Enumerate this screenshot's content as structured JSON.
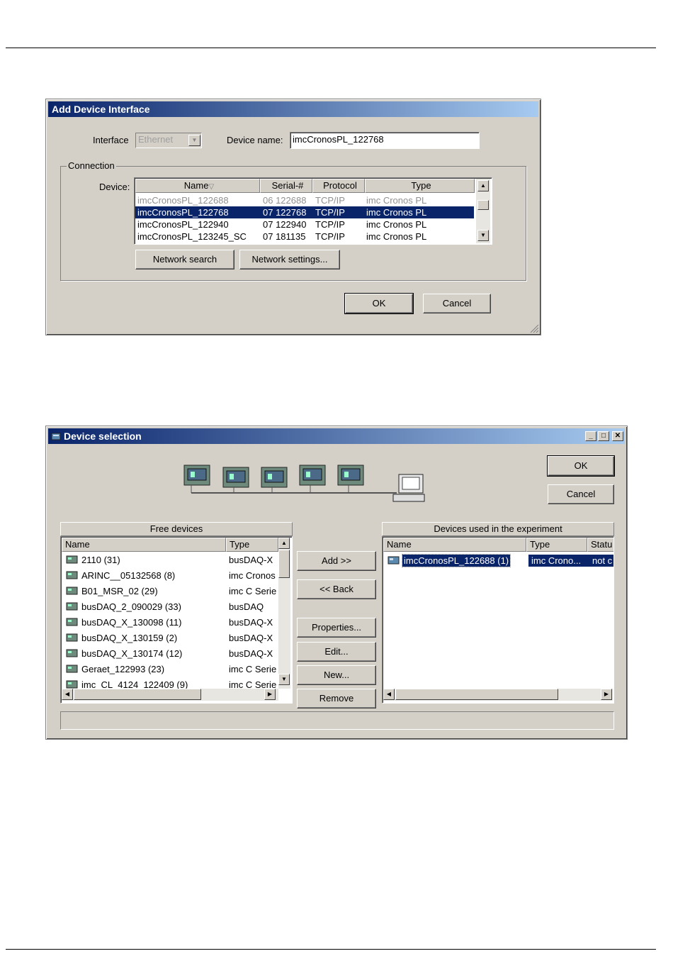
{
  "dialog1": {
    "title": "Add Device Interface",
    "interface_label": "Interface",
    "interface_value": "Ethernet",
    "device_name_label": "Device name:",
    "device_name_value": "imcCronosPL_122768",
    "connection_label": "Connection",
    "device_label": "Device:",
    "columns": [
      "Name",
      "Serial-#",
      "Protocol",
      "Type"
    ],
    "rows": [
      {
        "name": "imcCronosPL_122688",
        "serial": "06 122688",
        "protocol": "TCP/IP",
        "type": "imc Cronos PL"
      },
      {
        "name": "imcCronosPL_122768",
        "serial": "07 122768",
        "protocol": "TCP/IP",
        "type": "imc Cronos PL"
      },
      {
        "name": "imcCronosPL_122940",
        "serial": "07 122940",
        "protocol": "TCP/IP",
        "type": "imc Cronos PL"
      },
      {
        "name": "imcCronosPL_123245_SC",
        "serial": "07 181135",
        "protocol": "TCP/IP",
        "type": "imc Cronos PL"
      }
    ],
    "network_search": "Network search",
    "network_settings": "Network settings...",
    "ok": "OK",
    "cancel": "Cancel"
  },
  "dialog2": {
    "title": "Device selection",
    "ok": "OK",
    "cancel": "Cancel",
    "free_devices_label": "Free devices",
    "free_columns": [
      "Name",
      "Type"
    ],
    "free_rows": [
      {
        "name": "2110 (31)",
        "type": "busDAQ-X"
      },
      {
        "name": "ARINC__05132568 (8)",
        "type": "imc Cronos"
      },
      {
        "name": "B01_MSR_02 (29)",
        "type": "imc C Serie"
      },
      {
        "name": "busDAQ_2_090029 (33)",
        "type": "busDAQ"
      },
      {
        "name": "busDAQ_X_130098 (11)",
        "type": "busDAQ-X"
      },
      {
        "name": "busDAQ_X_130159 (2)",
        "type": "busDAQ-X"
      },
      {
        "name": "busDAQ_X_130174 (12)",
        "type": "busDAQ-X"
      },
      {
        "name": "Geraet_122993 (23)",
        "type": "imc C Serie"
      },
      {
        "name": "imc_CL_4124_122409 (9)",
        "type": "imc C Serie"
      }
    ],
    "used_label": "Devices used in the experiment",
    "used_columns": [
      "Name",
      "Type",
      "Statu"
    ],
    "used_rows": [
      {
        "name": "imcCronosPL_122688 (1)",
        "type": "imc Crono...",
        "status": "not c"
      }
    ],
    "add": "Add >>",
    "back": "<< Back",
    "properties": "Properties...",
    "edit": "Edit...",
    "new": "New...",
    "remove": "Remove"
  }
}
